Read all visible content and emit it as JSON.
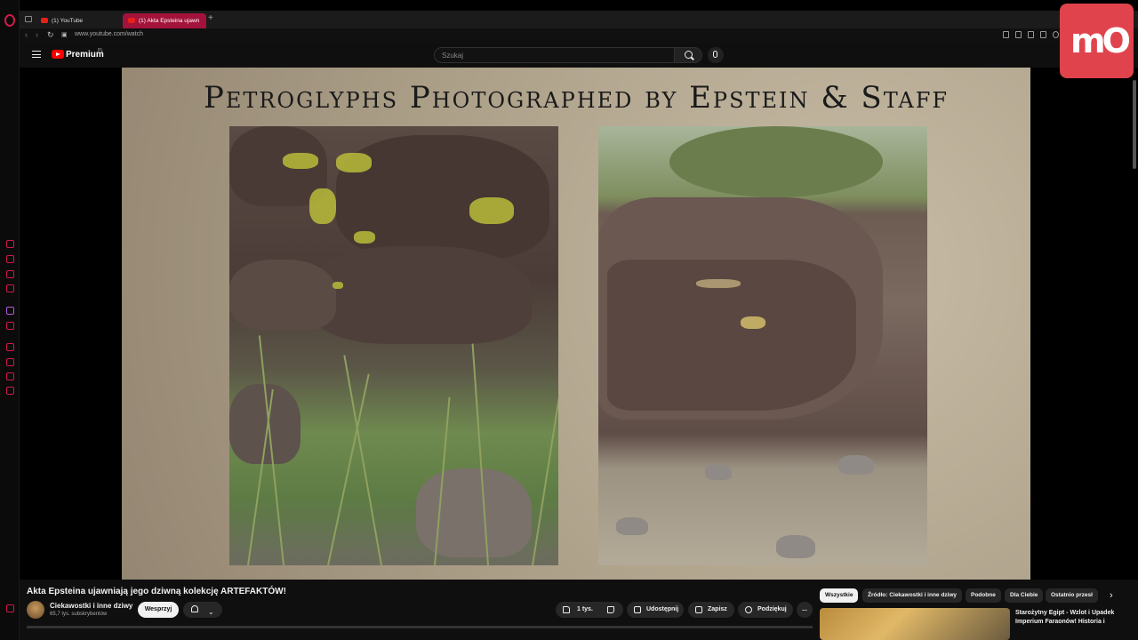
{
  "browser": {
    "tabs": [
      {
        "label": "(1) YouTube"
      },
      {
        "label": "(1) Akta Epsteina ujawn"
      }
    ],
    "url": "www.youtube.com/watch"
  },
  "header": {
    "brand": "Premium",
    "brand_sup": "PL",
    "search_placeholder": "Szukaj"
  },
  "overlay_logo": "mO",
  "slide": {
    "title": "Petroglyphs Photographed by Epstein & Staff"
  },
  "video": {
    "title": "Akta Epsteina ujawniają jego dziwną kolekcję ARTEFAKTÓW!",
    "channel": "Ciekawostki i inne dziwy",
    "subscribers": "65,7 tys. subskrybentów",
    "support_label": "Wesprzyj",
    "likes": "1 tys.",
    "share_label": "Udostępnij",
    "save_label": "Zapisz",
    "thanks_label": "Podziękuj",
    "more_label": "..."
  },
  "chips": [
    {
      "label": "Wszystkie",
      "active": true
    },
    {
      "label": "Źródło: Ciekawostki i inne dziwy",
      "active": false
    },
    {
      "label": "Podobne",
      "active": false
    },
    {
      "label": "Dla Ciebie",
      "active": false
    },
    {
      "label": "Ostatnio przesł",
      "active": false
    }
  ],
  "recommendation": {
    "title": "Starożytny Egipt - Wzlot i Upadek Imperium Faraonów! Historia i"
  },
  "colors": {
    "accent": "#d01a4a",
    "youtube_red": "#ff0000",
    "overlay": "#e0434c"
  }
}
